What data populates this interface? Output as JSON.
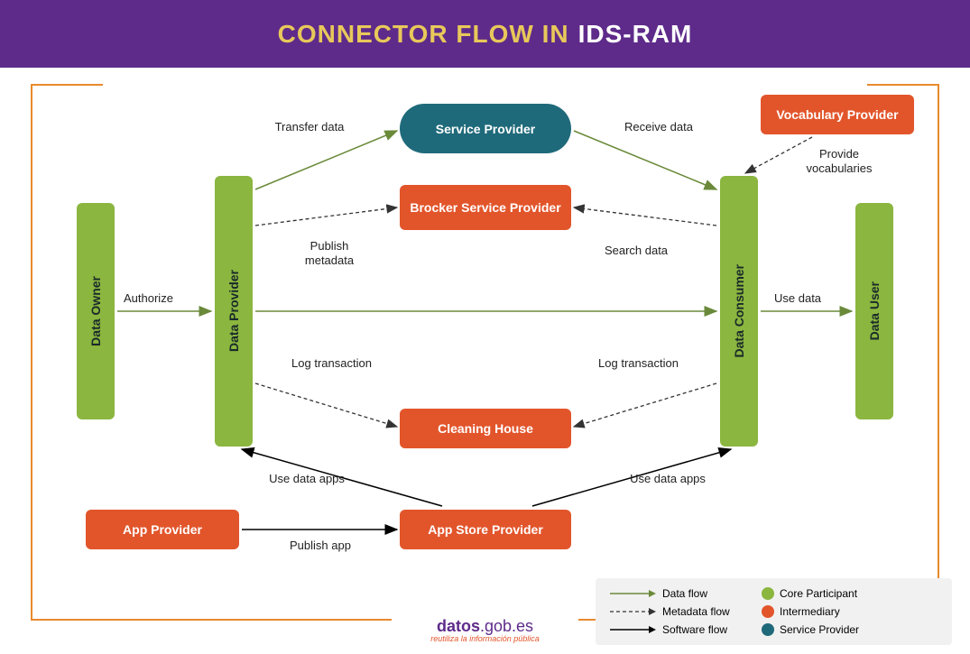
{
  "title": {
    "part1": "CONNECTOR FLOW IN",
    "part2": "IDS-RAM"
  },
  "nodes": {
    "data_owner": "Data Owner",
    "data_provider": "Data Provider",
    "data_consumer": "Data Consumer",
    "data_user": "Data User",
    "service_provider": "Service Provider",
    "brocker": "Brocker Service Provider",
    "vocabulary": "Vocabulary Provider",
    "cleaning": "Cleaning House",
    "app_provider": "App Provider",
    "app_store": "App Store Provider"
  },
  "labels": {
    "authorize": "Authorize",
    "transfer_data": "Transfer data",
    "receive_data": "Receive data",
    "provide_vocab": "Provide vocabularies",
    "publish_metadata": "Publish metadata",
    "search_data": "Search data",
    "use_data": "Use data",
    "log_transaction1": "Log transaction",
    "log_transaction2": "Log transaction",
    "use_data_apps1": "Use data apps",
    "use_data_apps2": "Use data apps",
    "publish_app": "Publish app"
  },
  "legend": {
    "data_flow": "Data flow",
    "metadata_flow": "Metadata flow",
    "software_flow": "Software flow",
    "core": "Core Participant",
    "intermediary": "Intermediary",
    "svc_provider": "Service Provider"
  },
  "footer": {
    "brand_bold": "datos",
    "brand_rest": ".gob.es",
    "tagline": "reutiliza la información pública"
  },
  "colors": {
    "core": "#8bb63f",
    "inter": "#e2552b",
    "svc": "#1f6a7a",
    "data_arrow": "#6a8a3a",
    "meta_arrow": "#333333",
    "soft_arrow": "#000000"
  }
}
